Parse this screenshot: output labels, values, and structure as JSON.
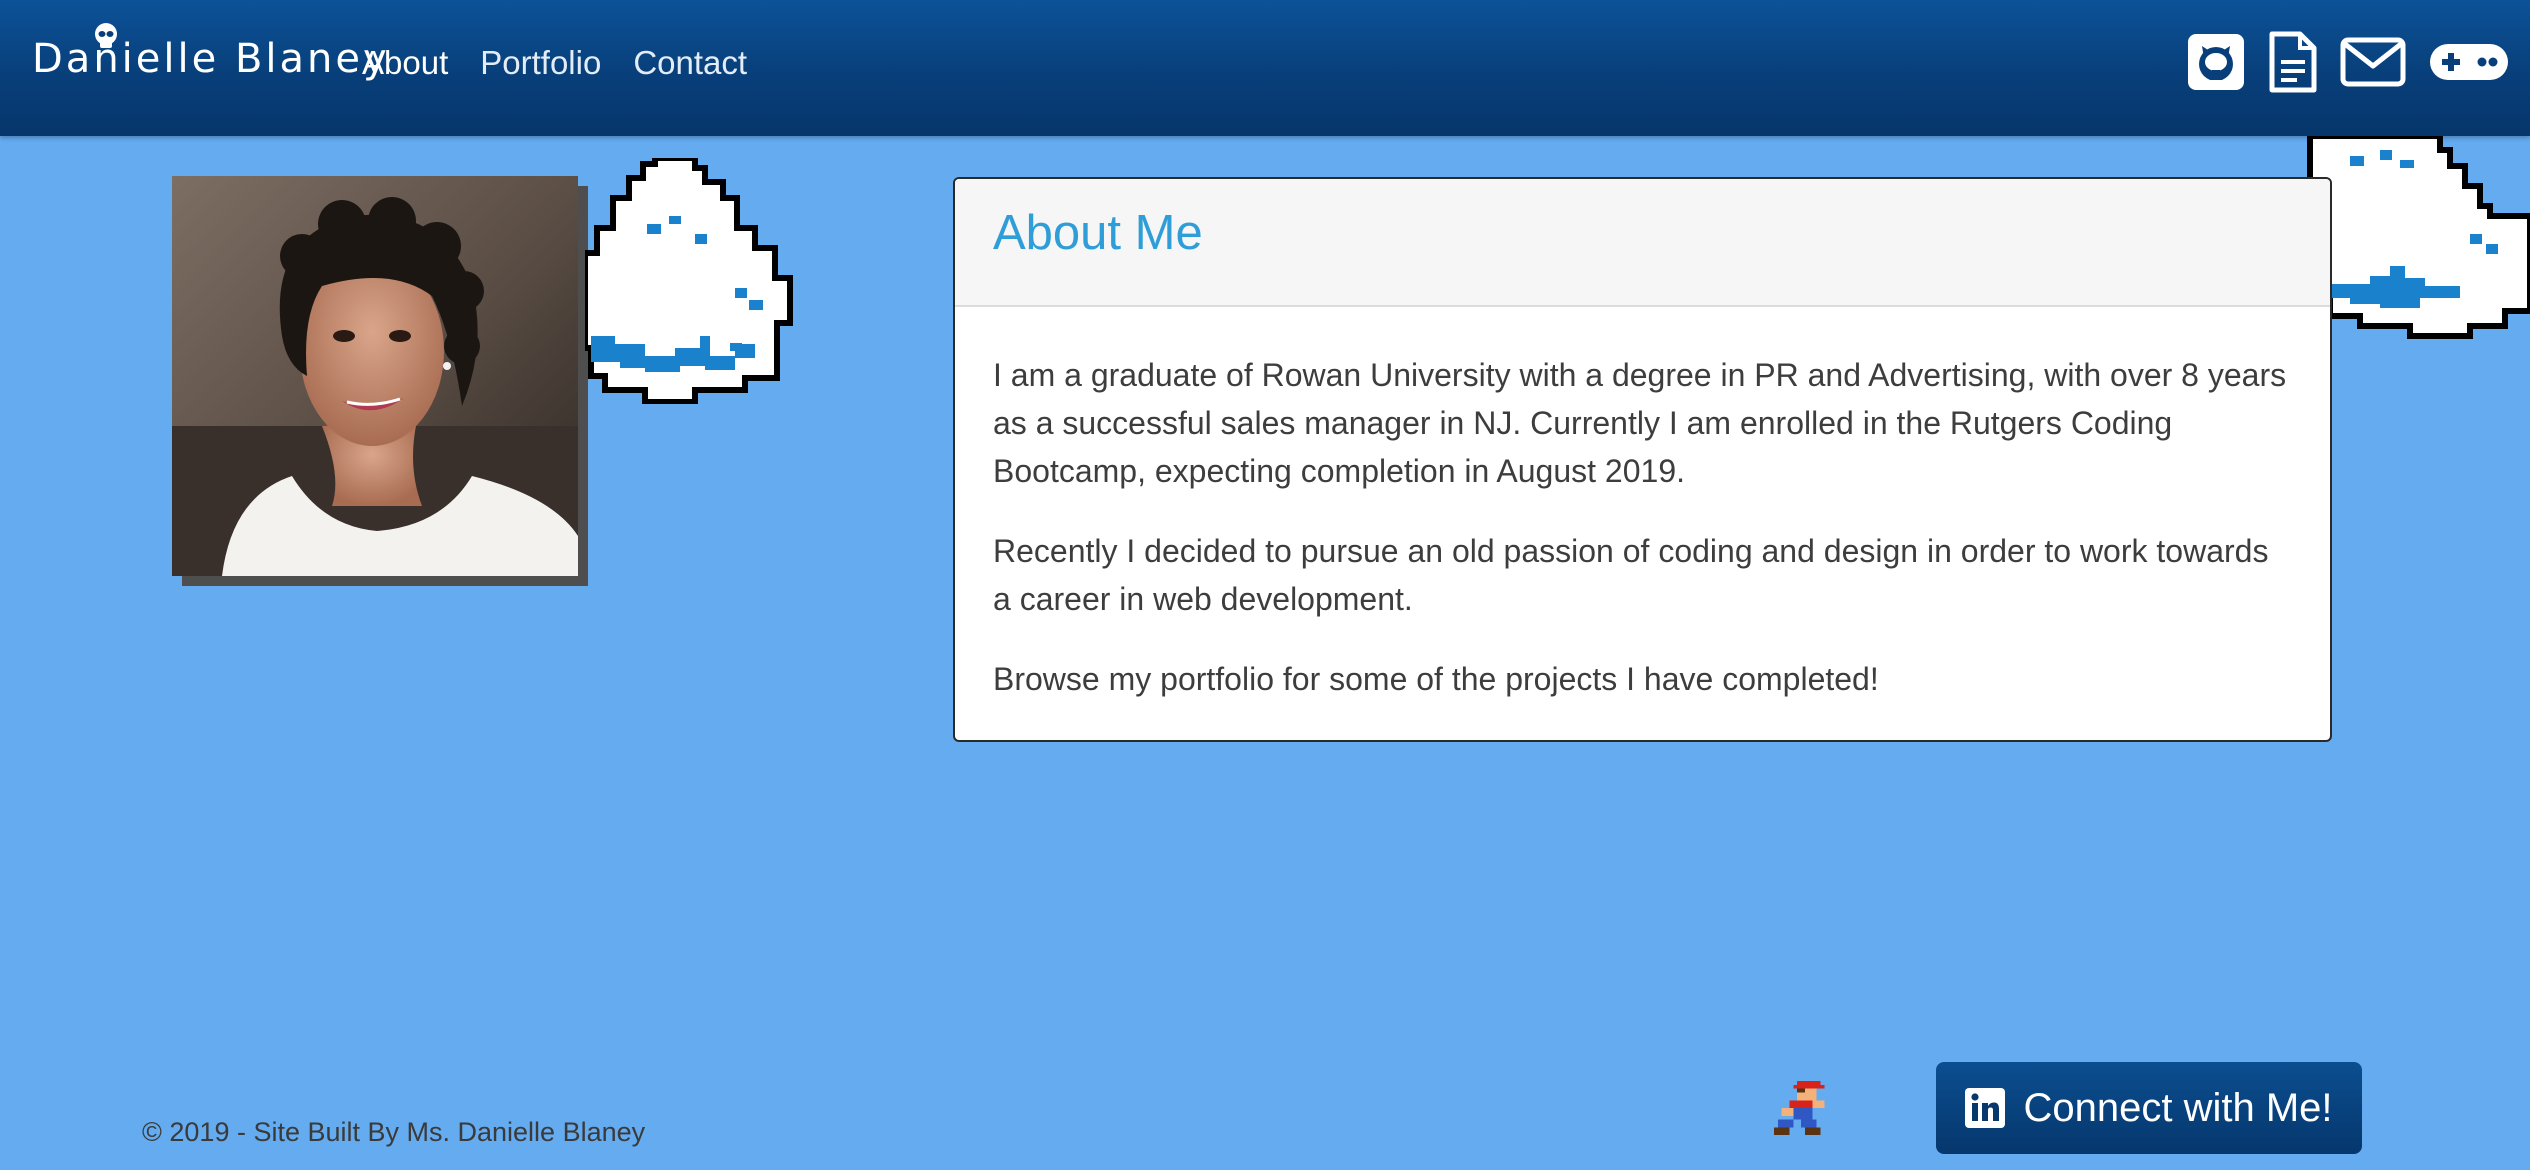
{
  "navbar": {
    "brand": "Danielle Blaney",
    "links": [
      {
        "label": "About",
        "active": true
      },
      {
        "label": "Portfolio",
        "active": false
      },
      {
        "label": "Contact",
        "active": false
      }
    ],
    "icons": [
      "github-icon",
      "resume-icon",
      "mail-icon",
      "gamepad-icon"
    ]
  },
  "about": {
    "title": "About Me",
    "paragraphs": [
      "I am a graduate of Rowan University with a degree in PR and Advertising, with over 8 years as a successful sales manager in NJ. Currently I am enrolled in the Rutgers Coding Bootcamp, expecting completion in August 2019.",
      "Recently I decided to pursue an old passion of coding and design in order to work towards a career in web development.",
      "Browse my portfolio for some of the projects I have completed!"
    ]
  },
  "footer": {
    "copyright": "© 2019 - Site Built By Ms. Danielle Blaney",
    "connect_label": "Connect with Me!"
  },
  "colors": {
    "background": "#64abf0",
    "navbar": "#083f7a",
    "title_accent": "#2f9ed8",
    "button": "#06376d"
  }
}
